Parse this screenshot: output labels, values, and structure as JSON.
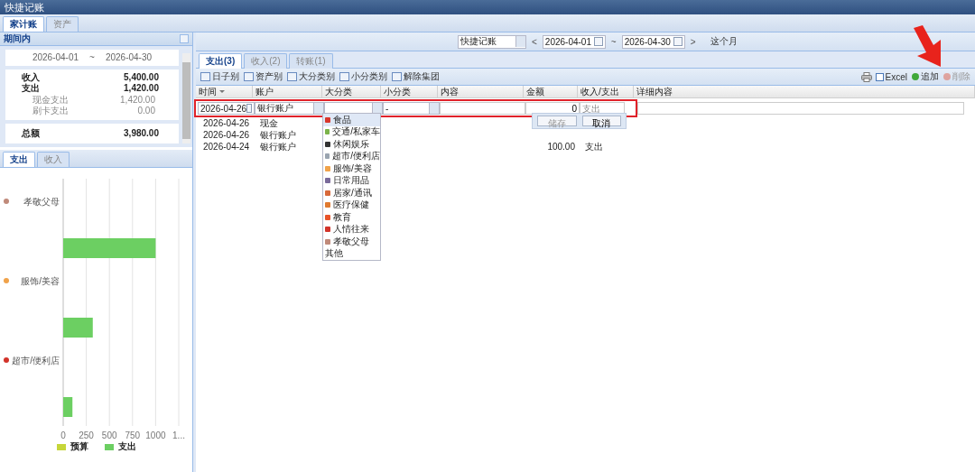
{
  "window": {
    "title": "快捷记账"
  },
  "top_tabs": [
    {
      "label": "家计账",
      "selected": true
    },
    {
      "label": "资产",
      "selected": false
    }
  ],
  "period_panel": {
    "title": "期间内",
    "date_from": "2026-04-01",
    "separator": "~",
    "date_to": "2026-04-30",
    "summary": [
      {
        "label": "收入",
        "value": "5,400.00",
        "kind": "main"
      },
      {
        "label": "支出",
        "value": "1,420.00",
        "kind": "main"
      },
      {
        "label": "现金支出",
        "value": "1,420.00",
        "kind": "sub"
      },
      {
        "label": "刷卡支出",
        "value": "0.00",
        "kind": "sub"
      }
    ],
    "total": {
      "label": "总额",
      "value": "3,980.00"
    }
  },
  "chart_tabs": [
    {
      "label": "支出",
      "selected": true
    },
    {
      "label": "收入",
      "selected": false
    }
  ],
  "chart": {
    "chart_data": {
      "type": "bar",
      "orientation": "horizontal",
      "categories": [
        "孝敬父母",
        "服饰/美容",
        "超市/便利店"
      ],
      "series": [
        {
          "name": "预算",
          "color": "#c6d63a",
          "values": [
            null,
            null,
            null
          ]
        },
        {
          "name": "支出",
          "color": "#6ccf62",
          "values": [
            1000,
            320,
            100
          ]
        }
      ],
      "xlim": [
        0,
        1250
      ],
      "grid": true,
      "xticks": [
        0,
        250,
        500,
        750,
        1000,
        {
          "value": 1250,
          "label": "1..."
        }
      ]
    }
  },
  "filter_bar": {
    "book": "快捷记账",
    "prev": "<",
    "date_from": "2026-04-01",
    "separator": "~",
    "date_to": "2026-04-30",
    "next": ">",
    "period": "这个月"
  },
  "list_tabs": [
    {
      "label": "支出(3)",
      "selected": true
    },
    {
      "label": "收入(2)",
      "selected": false
    },
    {
      "label": "转账(1)",
      "selected": false
    }
  ],
  "group_buttons": [
    "日子别",
    "资产别",
    "大分类别",
    "小分类别",
    "解除集团"
  ],
  "actions": [
    {
      "label": "Excel",
      "kind": "excel",
      "disabled": false
    },
    {
      "label": "追加",
      "kind": "add",
      "disabled": false
    },
    {
      "label": "削除",
      "kind": "delete",
      "disabled": true
    }
  ],
  "table": {
    "columns": [
      {
        "label": "时间",
        "sorted": true
      },
      {
        "label": "账户",
        "sorted": false
      },
      {
        "label": "大分类",
        "sorted": false
      },
      {
        "label": "小分类",
        "sorted": false
      },
      {
        "label": "内容",
        "sorted": false
      },
      {
        "label": "金额",
        "sorted": false
      },
      {
        "label": "收入/支出",
        "sorted": false
      },
      {
        "label": "详细内容",
        "sorted": false
      }
    ],
    "editor": {
      "date": "2026-04-26",
      "account": "银行账户",
      "subcategory": "-",
      "amount": "0",
      "type_placeholder": "支出",
      "save": "储存",
      "save_disabled": true,
      "cancel": "取消"
    },
    "rows": [
      {
        "date": "2026-04-26",
        "account": "现金"
      },
      {
        "date": "2026-04-26",
        "account": "银行账户"
      },
      {
        "date": "2026-04-24",
        "account": "银行账户",
        "amount": "100.00",
        "type": "支出"
      }
    ]
  },
  "category_dropdown": {
    "items": [
      {
        "label": "食品",
        "selected": true,
        "has_icon": true
      },
      {
        "label": "交通/私家车",
        "selected": false,
        "has_icon": true
      },
      {
        "label": "休闲娱乐",
        "selected": false,
        "has_icon": true
      },
      {
        "label": "超市/便利店",
        "selected": false,
        "has_icon": true
      },
      {
        "label": "服饰/美容",
        "selected": false,
        "has_icon": true
      },
      {
        "label": "日常用品",
        "selected": false,
        "has_icon": true
      },
      {
        "label": "居家/通讯",
        "selected": false,
        "has_icon": true
      },
      {
        "label": "医疗保健",
        "selected": false,
        "has_icon": true
      },
      {
        "label": "教育",
        "selected": false,
        "has_icon": true
      },
      {
        "label": "人情往来",
        "selected": false,
        "has_icon": true
      },
      {
        "label": "孝敬父母",
        "selected": false,
        "has_icon": true
      },
      {
        "label": "其他",
        "selected": false,
        "has_icon": false
      }
    ]
  },
  "annotation": {
    "highlight_frame": true,
    "pointer_arrow": true
  }
}
